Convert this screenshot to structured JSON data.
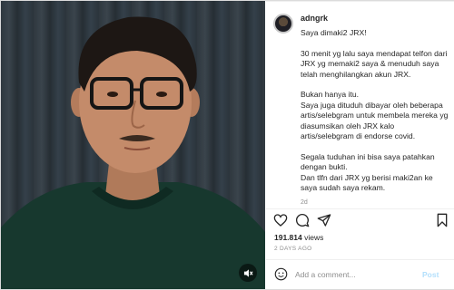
{
  "post": {
    "username": "adngrk",
    "caption": [
      "Saya dimaki2 JRX!",
      "30 menit yg lalu saya mendapat telfon dari JRX yg memaki2 saya & menuduh saya telah menghilangkan akun JRX.",
      "Bukan hanya itu.",
      "Saya juga dituduh dibayar oleh beberapa artis/selebgram untuk membela mereka yg diasumsikan oleh JRX kalo artis/selebgram di endorse covid.",
      "Segala tuduhan ini bisa saya patahkan dengan bukti.",
      "Dan tlfn dari JRX yg berisi maki2an ke saya sudah saya rekam."
    ],
    "caption_time": "2d",
    "likes_count": "191.814",
    "likes_label": "views",
    "posted_ago": "2 DAYS AGO"
  },
  "comment": {
    "placeholder": "Add a comment...",
    "post_label": "Post"
  },
  "icons": {
    "like": "heart-icon",
    "comment": "comment-bubble-icon",
    "share": "paper-plane-icon",
    "save": "bookmark-icon",
    "emoji": "smiley-icon",
    "mute": "speaker-muted-icon"
  },
  "colors": {
    "post_button": "#b2dffc",
    "secondary_text": "#8e8e8e",
    "shirt": "#17382e"
  }
}
